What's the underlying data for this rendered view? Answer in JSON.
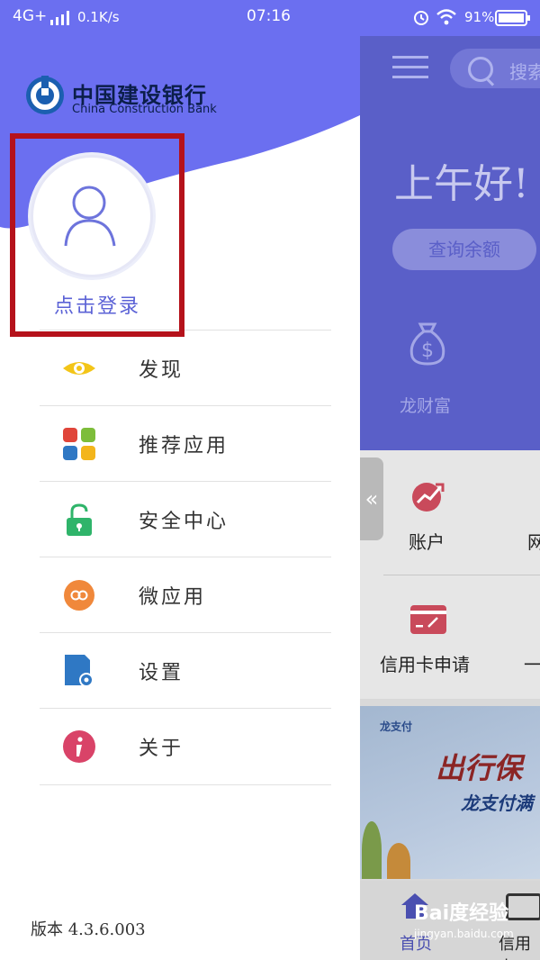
{
  "status_bar": {
    "network": "4G+",
    "speed": "0.1K/s",
    "time": "07:16",
    "battery": "91%"
  },
  "drawer": {
    "logo": {
      "cn": "中国建设银行",
      "en": "China Construction Bank"
    },
    "login_label": "点击登录",
    "menu": [
      {
        "label": "发现",
        "icon": "eye-icon"
      },
      {
        "label": "推荐应用",
        "icon": "apps-grid-icon"
      },
      {
        "label": "安全中心",
        "icon": "lock-icon"
      },
      {
        "label": "微应用",
        "icon": "link-icon"
      },
      {
        "label": "设置",
        "icon": "settings-icon"
      },
      {
        "label": "关于",
        "icon": "info-icon"
      }
    ],
    "version": "版本 4.3.6.003"
  },
  "main": {
    "search_placeholder": "搜索",
    "greeting": "上午好!",
    "balance_button": "查询余额",
    "longcaifu_label": "龙财富",
    "account_label": "账户",
    "wang_label": "网",
    "credit_card_label": "信用卡申请",
    "dash_label": "一",
    "banner": {
      "logo_text": "龙支付",
      "title": "出行保",
      "subtitle": "龙支付满"
    },
    "bottom_nav": {
      "home": "首页",
      "credit": "信用卡"
    }
  },
  "watermark": {
    "brand": "Bai度经验",
    "url": "jingyan.baidu.com"
  },
  "colors": {
    "drawer_accent": "#6b6ff0",
    "login_text": "#5b62d6",
    "highlight_border": "#b5121b"
  }
}
